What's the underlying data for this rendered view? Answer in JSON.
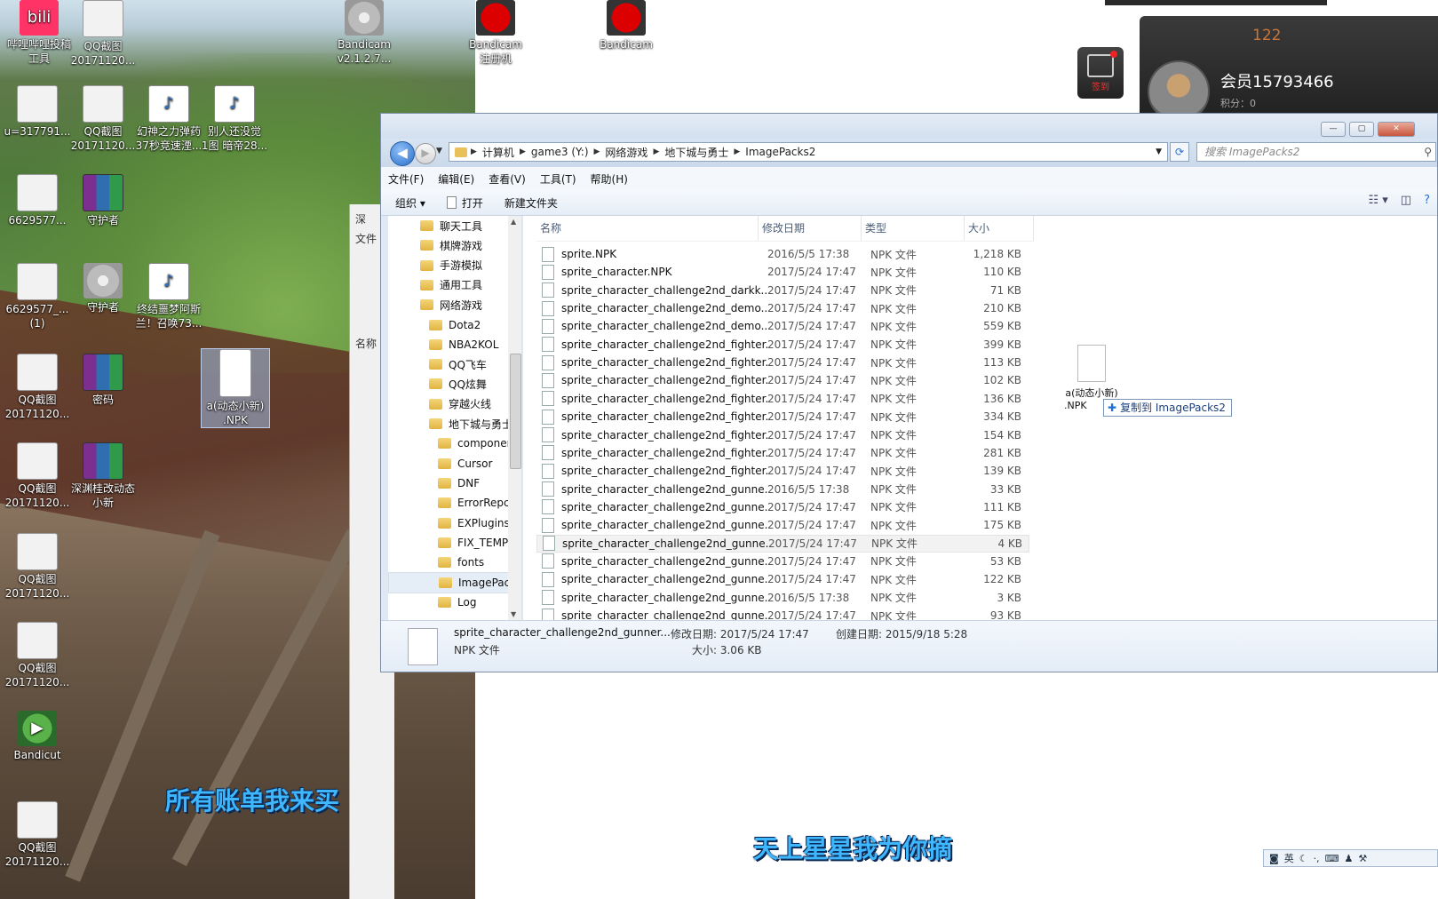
{
  "desktop": {
    "icons": [
      {
        "label": "哔哩哔哩投稿\n工具",
        "glyph": "bilibili"
      },
      {
        "label": "QQ截图\n20171120...",
        "glyph": "photo"
      },
      {
        "label": "Bandicam\nv2.1.2.7...",
        "glyph": "disc"
      },
      {
        "label": "Bandicam\n注册机",
        "glyph": "red"
      },
      {
        "label": "Bandicam",
        "glyph": "red"
      },
      {
        "label": "u=317791...",
        "glyph": "photo"
      },
      {
        "label": "QQ截图\n20171120...",
        "glyph": "photo"
      },
      {
        "label": "幻神之力弹药\n37秒竞速湮...",
        "glyph": "audio"
      },
      {
        "label": "别人还没觉\n1图 暗帝28...",
        "glyph": "audio"
      },
      {
        "label": "6629577...",
        "glyph": "photo"
      },
      {
        "label": "守护者",
        "glyph": "rar"
      },
      {
        "label": "6629577_...\n(1)",
        "glyph": "photo"
      },
      {
        "label": "守护者",
        "glyph": "disc"
      },
      {
        "label": "终结噩梦阿斯\n兰！召唤73...",
        "glyph": "audio"
      },
      {
        "label": "a(动态小新)\n.NPK",
        "glyph": "file"
      },
      {
        "label": "QQ截图\n20171120...",
        "glyph": "photo"
      },
      {
        "label": "密码",
        "glyph": "rar"
      },
      {
        "label": "QQ截图\n20171120...",
        "glyph": "photo"
      },
      {
        "label": "深渊桂改动态\n小新",
        "glyph": "rar"
      },
      {
        "label": "QQ截图\n20171120...",
        "glyph": "photo"
      },
      {
        "label": "QQ截图\n20171120...",
        "glyph": "photo"
      },
      {
        "label": "Bandicut",
        "glyph": "bandicut"
      },
      {
        "label": "QQ截图\n20171120...",
        "glyph": "photo"
      }
    ]
  },
  "back_window": {
    "menu_label": "文件",
    "col_label": "名称",
    "title_char": "深"
  },
  "qq": {
    "count": "122",
    "username": "会员15793466",
    "points": "积分：0",
    "sign_label": "签到"
  },
  "explorer": {
    "window_buttons": [
      "—",
      "▢",
      "✕"
    ],
    "breadcrumb": [
      "计算机",
      "game3 (Y:)",
      "网络游戏",
      "地下城与勇士",
      "ImagePacks2"
    ],
    "search_placeholder": "搜索 ImagePacks2",
    "menu": [
      "文件(F)",
      "编辑(E)",
      "查看(V)",
      "工具(T)",
      "帮助(H)"
    ],
    "toolbar": {
      "organize": "组织 ▾",
      "open": "打开",
      "new_folder": "新建文件夹"
    },
    "tree": [
      {
        "label": "聊天工具",
        "indent": 0
      },
      {
        "label": "棋牌游戏",
        "indent": 0
      },
      {
        "label": "手游模拟",
        "indent": 0
      },
      {
        "label": "通用工具",
        "indent": 0
      },
      {
        "label": "网络游戏",
        "indent": 0
      },
      {
        "label": "Dota2",
        "indent": 1
      },
      {
        "label": "NBA2KOL",
        "indent": 1
      },
      {
        "label": "QQ飞车",
        "indent": 1
      },
      {
        "label": "QQ炫舞",
        "indent": 1
      },
      {
        "label": "穿越火线",
        "indent": 1
      },
      {
        "label": "地下城与勇士",
        "indent": 1
      },
      {
        "label": "componen",
        "indent": 2
      },
      {
        "label": "Cursor",
        "indent": 2
      },
      {
        "label": "DNF",
        "indent": 2
      },
      {
        "label": "ErrorRepc",
        "indent": 2
      },
      {
        "label": "EXPlugins",
        "indent": 2
      },
      {
        "label": "FIX_TEMP_",
        "indent": 2
      },
      {
        "label": "fonts",
        "indent": 2
      },
      {
        "label": "ImagePacl",
        "indent": 2,
        "selected": true
      },
      {
        "label": "Log",
        "indent": 2
      }
    ],
    "columns": [
      "名称",
      "修改日期",
      "类型",
      "大小"
    ],
    "files": [
      [
        "sprite.NPK",
        "2016/5/5 17:38",
        "NPK 文件",
        "1,218 KB"
      ],
      [
        "sprite_character.NPK",
        "2017/5/24 17:47",
        "NPK 文件",
        "110 KB"
      ],
      [
        "sprite_character_challenge2nd_darkk...",
        "2017/5/24 17:47",
        "NPK 文件",
        "71 KB"
      ],
      [
        "sprite_character_challenge2nd_demo...",
        "2017/5/24 17:47",
        "NPK 文件",
        "210 KB"
      ],
      [
        "sprite_character_challenge2nd_demo...",
        "2017/5/24 17:47",
        "NPK 文件",
        "559 KB"
      ],
      [
        "sprite_character_challenge2nd_fighter...",
        "2017/5/24 17:47",
        "NPK 文件",
        "399 KB"
      ],
      [
        "sprite_character_challenge2nd_fighter...",
        "2017/5/24 17:47",
        "NPK 文件",
        "113 KB"
      ],
      [
        "sprite_character_challenge2nd_fighter...",
        "2017/5/24 17:47",
        "NPK 文件",
        "102 KB"
      ],
      [
        "sprite_character_challenge2nd_fighter...",
        "2017/5/24 17:47",
        "NPK 文件",
        "136 KB"
      ],
      [
        "sprite_character_challenge2nd_fighter...",
        "2017/5/24 17:47",
        "NPK 文件",
        "334 KB"
      ],
      [
        "sprite_character_challenge2nd_fighter...",
        "2017/5/24 17:47",
        "NPK 文件",
        "154 KB"
      ],
      [
        "sprite_character_challenge2nd_fighter...",
        "2017/5/24 17:47",
        "NPK 文件",
        "281 KB"
      ],
      [
        "sprite_character_challenge2nd_fighter...",
        "2017/5/24 17:47",
        "NPK 文件",
        "139 KB"
      ],
      [
        "sprite_character_challenge2nd_gunne...",
        "2016/5/5 17:38",
        "NPK 文件",
        "33 KB"
      ],
      [
        "sprite_character_challenge2nd_gunne...",
        "2017/5/24 17:47",
        "NPK 文件",
        "111 KB"
      ],
      [
        "sprite_character_challenge2nd_gunne...",
        "2017/5/24 17:47",
        "NPK 文件",
        "175 KB"
      ],
      [
        "sprite_character_challenge2nd_gunne...",
        "2017/5/24 17:47",
        "NPK 文件",
        "4 KB"
      ],
      [
        "sprite_character_challenge2nd_gunne...",
        "2017/5/24 17:47",
        "NPK 文件",
        "53 KB"
      ],
      [
        "sprite_character_challenge2nd_gunne...",
        "2017/5/24 17:47",
        "NPK 文件",
        "122 KB"
      ],
      [
        "sprite_character_challenge2nd_gunne...",
        "2016/5/5 17:38",
        "NPK 文件",
        "3 KB"
      ],
      [
        "sprite_character_challenge2nd_gunne...",
        "2017/5/24 17:47",
        "NPK 文件",
        "93 KB"
      ]
    ],
    "hovered_row": 16,
    "drag": {
      "ghost_label_1": "a(动态小新)",
      "ghost_label_2": ".NPK",
      "tip": "复制到 ImagePacks2"
    },
    "details": {
      "name": "sprite_character_challenge2nd_gunner...",
      "type": "NPK 文件",
      "modified": "修改日期: 2017/5/24 17:47",
      "size": "大小: 3.06 KB",
      "created": "创建日期: 2015/9/18 5:28"
    }
  },
  "subtitles": {
    "line1": "所有账单我来买",
    "line2": "天上星星我为你摘"
  },
  "ime": {
    "lang": "英"
  }
}
